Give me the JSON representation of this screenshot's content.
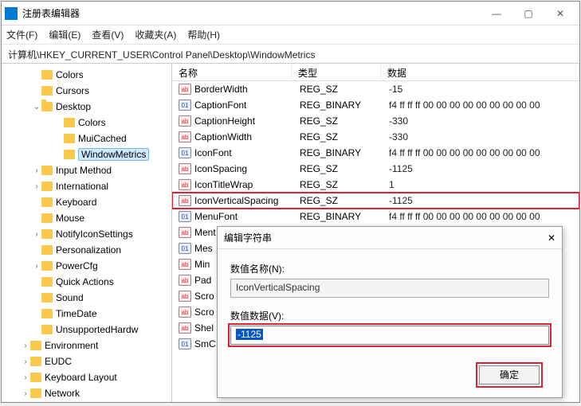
{
  "title": "注册表编辑器",
  "menus": [
    "文件(F)",
    "编辑(E)",
    "查看(V)",
    "收藏夹(A)",
    "帮助(H)"
  ],
  "address": "计算机\\HKEY_CURRENT_USER\\Control Panel\\Desktop\\WindowMetrics",
  "tree": [
    {
      "ind": 38,
      "tw": "",
      "lbl": "Colors"
    },
    {
      "ind": 38,
      "tw": "",
      "lbl": "Cursors"
    },
    {
      "ind": 38,
      "tw": "v",
      "lbl": "Desktop",
      "open": true
    },
    {
      "ind": 66,
      "tw": "",
      "lbl": "Colors"
    },
    {
      "ind": 66,
      "tw": "",
      "lbl": "MuiCached"
    },
    {
      "ind": 66,
      "tw": "",
      "lbl": "WindowMetrics",
      "sel": true
    },
    {
      "ind": 38,
      "tw": ">",
      "lbl": "Input Method"
    },
    {
      "ind": 38,
      "tw": ">",
      "lbl": "International"
    },
    {
      "ind": 38,
      "tw": "",
      "lbl": "Keyboard"
    },
    {
      "ind": 38,
      "tw": "",
      "lbl": "Mouse"
    },
    {
      "ind": 38,
      "tw": ">",
      "lbl": "NotifyIconSettings"
    },
    {
      "ind": 38,
      "tw": "",
      "lbl": "Personalization"
    },
    {
      "ind": 38,
      "tw": ">",
      "lbl": "PowerCfg"
    },
    {
      "ind": 38,
      "tw": "",
      "lbl": "Quick Actions"
    },
    {
      "ind": 38,
      "tw": "",
      "lbl": "Sound"
    },
    {
      "ind": 38,
      "tw": "",
      "lbl": "TimeDate"
    },
    {
      "ind": 38,
      "tw": "",
      "lbl": "UnsupportedHardw"
    },
    {
      "ind": 24,
      "tw": ">",
      "lbl": "Environment"
    },
    {
      "ind": 24,
      "tw": ">",
      "lbl": "EUDC"
    },
    {
      "ind": 24,
      "tw": ">",
      "lbl": "Keyboard Layout"
    },
    {
      "ind": 24,
      "tw": ">",
      "lbl": "Network"
    }
  ],
  "cols": {
    "name": "名称",
    "type": "类型",
    "data": "数据"
  },
  "rows": [
    {
      "i": "sz",
      "n": "BorderWidth",
      "t": "REG_SZ",
      "d": "-15"
    },
    {
      "i": "bn",
      "n": "CaptionFont",
      "t": "REG_BINARY",
      "d": "f4 ff ff ff 00 00 00 00 00 00 00 00 00"
    },
    {
      "i": "sz",
      "n": "CaptionHeight",
      "t": "REG_SZ",
      "d": "-330"
    },
    {
      "i": "sz",
      "n": "CaptionWidth",
      "t": "REG_SZ",
      "d": "-330"
    },
    {
      "i": "bn",
      "n": "IconFont",
      "t": "REG_BINARY",
      "d": "f4 ff ff ff 00 00 00 00 00 00 00 00 00"
    },
    {
      "i": "sz",
      "n": "IconSpacing",
      "t": "REG_SZ",
      "d": "-1125"
    },
    {
      "i": "sz",
      "n": "IconTitleWrap",
      "t": "REG_SZ",
      "d": "1"
    },
    {
      "i": "sz",
      "n": "IconVerticalSpacing",
      "t": "REG_SZ",
      "d": "-1125",
      "hl": true
    },
    {
      "i": "bn",
      "n": "MenuFont",
      "t": "REG_BINARY",
      "d": "f4 ff ff ff 00 00 00 00 00 00 00 00 00"
    },
    {
      "i": "sz",
      "n": "Ment"
    },
    {
      "i": "bn",
      "n": "Mes"
    },
    {
      "i": "sz",
      "n": "Min"
    },
    {
      "i": "sz",
      "n": "Pad"
    },
    {
      "i": "sz",
      "n": "Scro"
    },
    {
      "i": "sz",
      "n": "Scro"
    },
    {
      "i": "sz",
      "n": "Shel"
    },
    {
      "i": "bn",
      "n": "SmC"
    }
  ],
  "dialog": {
    "title": "编辑字符串",
    "name_lbl": "数值名称(N):",
    "name_val": "IconVerticalSpacing",
    "data_lbl": "数值数据(V):",
    "data_val": "-1125",
    "ok": "确定"
  }
}
